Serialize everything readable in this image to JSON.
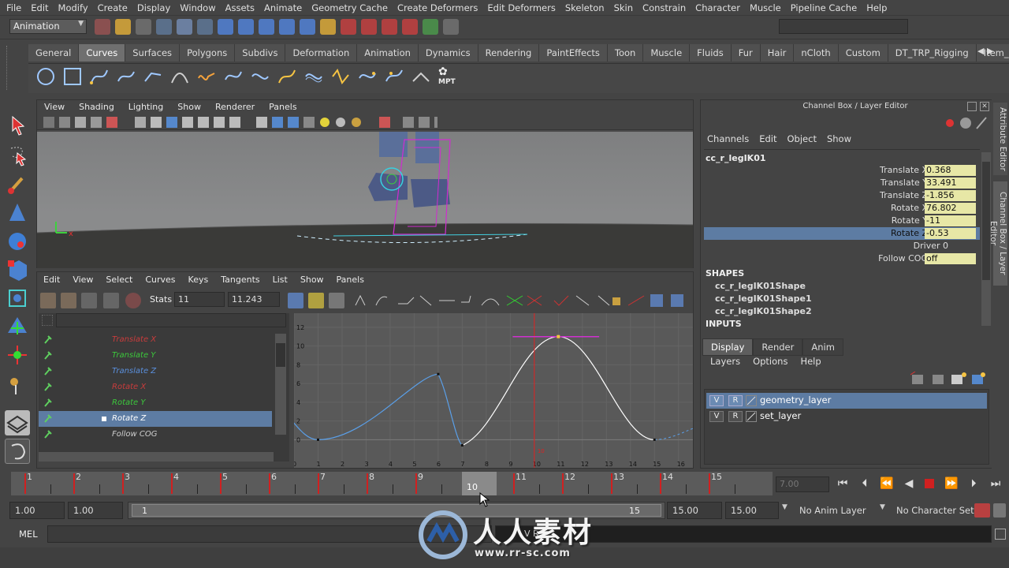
{
  "menubar": [
    "File",
    "Edit",
    "Modify",
    "Create",
    "Display",
    "Window",
    "Assets",
    "Animate",
    "Geometry Cache",
    "Create Deformers",
    "Edit Deformers",
    "Skeleton",
    "Skin",
    "Constrain",
    "Character",
    "Muscle",
    "Pipeline Cache",
    "Help"
  ],
  "mode": "Animation",
  "shelf_tabs": [
    "General",
    "Curves",
    "Surfaces",
    "Polygons",
    "Subdivs",
    "Deformation",
    "Animation",
    "Dynamics",
    "Rendering",
    "PaintEffects",
    "Toon",
    "Muscle",
    "Fluids",
    "Fur",
    "Hair",
    "nCloth",
    "Custom",
    "DT_TRP_Rigging",
    "Item_s"
  ],
  "shelf_active": "Curves",
  "shelf_mpt_label": "MPT",
  "viewport": {
    "menu": [
      "View",
      "Shading",
      "Lighting",
      "Show",
      "Renderer",
      "Panels"
    ]
  },
  "graph_editor": {
    "menu": [
      "Edit",
      "View",
      "Select",
      "Curves",
      "Keys",
      "Tangents",
      "List",
      "Show",
      "Panels"
    ],
    "stats_label": "Stats",
    "stats_frame": "11",
    "stats_value": "11.243",
    "curves": [
      {
        "name": "Translate X",
        "color": "#c83c3c"
      },
      {
        "name": "Translate Y",
        "color": "#3cc83c"
      },
      {
        "name": "Translate Z",
        "color": "#5a8fdc"
      },
      {
        "name": "Rotate X",
        "color": "#c83c3c"
      },
      {
        "name": "Rotate Y",
        "color": "#3cc83c"
      },
      {
        "name": "Rotate Z",
        "color": "#ffffff"
      },
      {
        "name": "Follow COG",
        "color": "#cfcfcf"
      }
    ],
    "selected_curve": "Rotate Z",
    "y_ticks": [
      "12",
      "10",
      "8",
      "6",
      "4",
      "2",
      "0"
    ],
    "x_ticks": [
      "0",
      "1",
      "2",
      "3",
      "4",
      "5",
      "6",
      "7",
      "8",
      "9",
      "10",
      "11",
      "12",
      "13",
      "14",
      "15",
      "16"
    ],
    "current_frame_label": "10"
  },
  "channel_box": {
    "title": "Channel Box / Layer Editor",
    "menu": [
      "Channels",
      "Edit",
      "Object",
      "Show"
    ],
    "node": "cc_r_legIK01",
    "attributes": [
      {
        "name": "Translate X",
        "value": "0.368"
      },
      {
        "name": "Translate Y",
        "value": "33.491"
      },
      {
        "name": "Translate Z",
        "value": "-1.856"
      },
      {
        "name": "Rotate X",
        "value": "76.802"
      },
      {
        "name": "Rotate Y",
        "value": "-11"
      },
      {
        "name": "Rotate Z",
        "value": "-0.53"
      }
    ],
    "plain_attributes": [
      {
        "name": "Driver",
        "value": "0"
      }
    ],
    "follow_cog": {
      "name": "Follow COG",
      "value": "off"
    },
    "shapes_header": "SHAPES",
    "shapes": [
      "cc_r_legIK01Shape",
      "cc_r_legIK01Shape1",
      "cc_r_legIK01Shape2"
    ],
    "inputs_header": "INPUTS"
  },
  "layer_editor": {
    "tabs": [
      "Display",
      "Render",
      "Anim"
    ],
    "active_tab": "Display",
    "menu": [
      "Layers",
      "Options",
      "Help"
    ],
    "layers": [
      {
        "v": "V",
        "r": "R",
        "name": "geometry_layer"
      },
      {
        "v": "V",
        "r": "R",
        "name": "set_layer"
      }
    ]
  },
  "sidebar_tabs": [
    "Attribute Editor",
    "Channel Box / Layer Editor"
  ],
  "timeline": {
    "frames": [
      "1",
      "2",
      "3",
      "4",
      "5",
      "6",
      "7",
      "8",
      "9",
      "10",
      "11",
      "12",
      "13",
      "14",
      "15"
    ],
    "current_frame": "10",
    "current_field": "7.00"
  },
  "range": {
    "start": "1.00",
    "anim_start": "1.00",
    "slider_start": "1",
    "slider_end": "15",
    "anim_end": "15.00",
    "end": "15.00",
    "anim_layer": "No Anim Layer",
    "character_set": "No Character Set"
  },
  "command_line": {
    "label": "MEL",
    "result": "V R"
  },
  "watermark": {
    "cn": "人人素材",
    "url": "www.rr-sc.com"
  }
}
